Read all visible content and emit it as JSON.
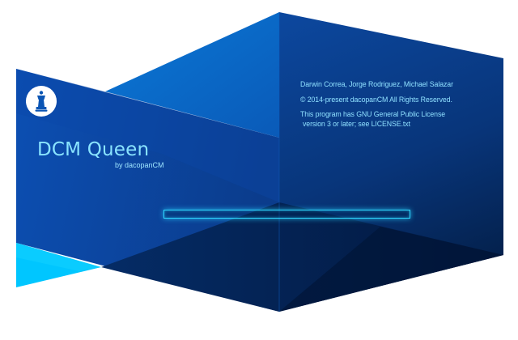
{
  "app": {
    "title": "DCM Queen",
    "byline": "by dacopanCM"
  },
  "logo": {
    "icon": "chess-queen-icon"
  },
  "about": {
    "authors": "Darwin Correa, Jorge Rodriguez, Michael Salazar",
    "copyright": "© 2014-present dacopanCM  All Rights Reserved.",
    "license_line1": "This program has GNU General Public License",
    "license_line2": "version 3 or later; see LICENSE.txt"
  },
  "progress": {
    "fraction": 0
  },
  "colors": {
    "accent": "#2fd8ff",
    "text": "#8fe0ff",
    "bright_panel": "#00c6ff",
    "deep_panel": "#031f4d"
  }
}
